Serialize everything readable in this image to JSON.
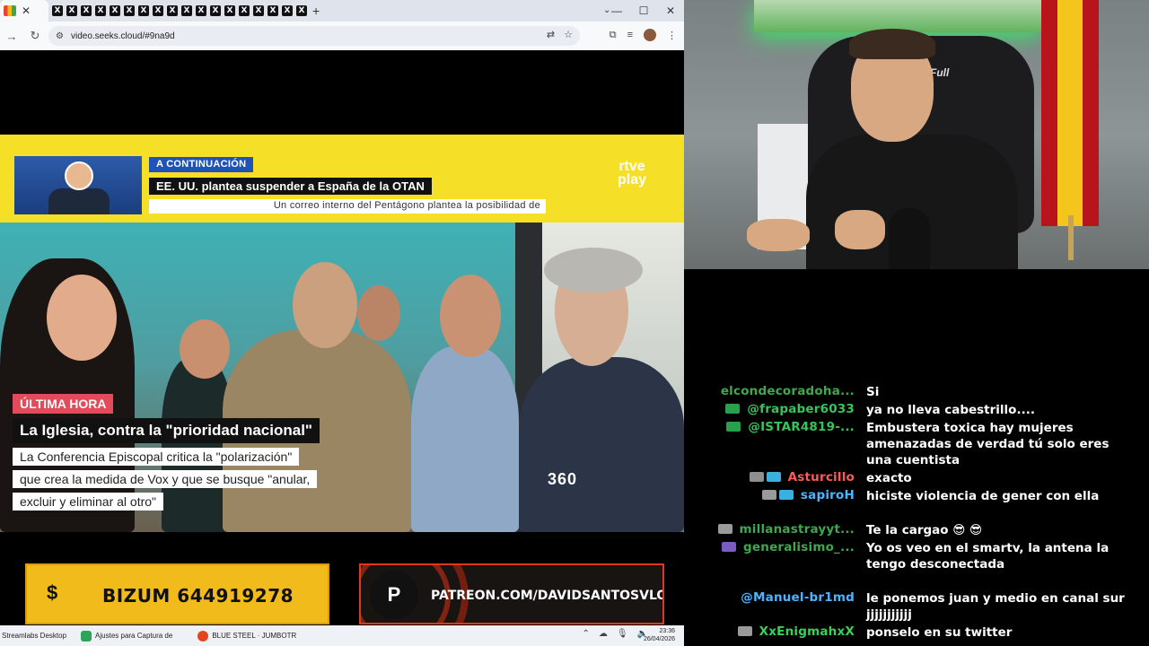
{
  "browser": {
    "active_tab_icon": "gmail-icon",
    "tab_icon_glyphs": [
      "X",
      "X",
      "X",
      "X",
      "X",
      "X",
      "X",
      "X",
      "X",
      "X",
      "X",
      "X",
      "X",
      "X",
      "X",
      "X",
      "X",
      "X"
    ],
    "new_tab": "+",
    "url": "video.seeks.cloud/#9na9d",
    "window_controls": {
      "minimize": "—",
      "maximize": "☐",
      "close": "✕"
    }
  },
  "broadcast": {
    "upnext_kicker": "A CONTINUACIÓN",
    "upnext_title": "EE. UU. plantea suspender a España de la OTAN",
    "upnext_subtitle": "Un correo interno del Pentágono plantea la posibilidad de",
    "channel_logo_line1": "rtve",
    "channel_logo_line2": "play",
    "kicker": "ÚLTIMA HORA",
    "headline": "La Iglesia, contra la \"prioridad nacional\"",
    "body_lines": [
      "La Conferencia Episcopal critica la \"polarización\"",
      "que crea la medida de Vox y que se busque \"anular,",
      "excluir y eliminar al otro\""
    ],
    "badge": "360"
  },
  "promos": {
    "bizum_icon": "$",
    "bizum_text": "BIZUM 644919278",
    "patreon_text": "PATREON.COM/DAVIDSANTOSVLOG"
  },
  "taskbar": {
    "items": [
      "Streamlabs Desktop",
      "Ajustes para Captura de",
      "BLUE STEEL · JUMBOTR"
    ],
    "time": "23:36",
    "date": "26/04/2026"
  },
  "webcam": {
    "chair_brand": "Full"
  },
  "chat": {
    "messages": [
      {
        "user": "elcondecoradoha...",
        "color": "#3fa84f",
        "text": "Si",
        "badges": []
      },
      {
        "user": "@frapaber6033",
        "color": "#36c55a",
        "text": "ya no lleva cabestrillo....",
        "badges": [
          "#27a14a"
        ]
      },
      {
        "user": "@ISTAR4819-...",
        "color": "#36c55a",
        "text": "Embustera toxica hay mujeres amenazadas de verdad tú solo eres una cuentista",
        "badges": [
          "#27a14a"
        ]
      },
      {
        "user": "Asturcillo",
        "color": "#ff5a5a",
        "text": "exacto",
        "badges": [
          "#8f8f8f",
          "#3ab0e0"
        ]
      },
      {
        "user": "sapiroH",
        "color": "#4ab6ff",
        "text": "hiciste violencia de gener con ella",
        "badges": [
          "#9a9a9a",
          "#3ab0e0"
        ]
      },
      {
        "user": "millanastrayyt...",
        "color": "#3fa84f",
        "text": "Te la cargao 😎 😎",
        "badges": [
          "#9a9a9a"
        ]
      },
      {
        "user": "generalisimo_...",
        "color": "#3fa84f",
        "text": "Yo os veo en el smartv, la antena la tengo desconectada",
        "badges": [
          "#7b5cc0"
        ]
      },
      {
        "user": "@Manuel-br1md",
        "color": "#4ab6ff",
        "text": "le ponemos juan y medio en canal sur jjjjjjjjjjj",
        "badges": []
      },
      {
        "user": "XxEnigmahxX",
        "color": "#36d35a",
        "text": "ponselo en su twitter",
        "badges": [
          "#9a9a9a"
        ]
      }
    ]
  }
}
